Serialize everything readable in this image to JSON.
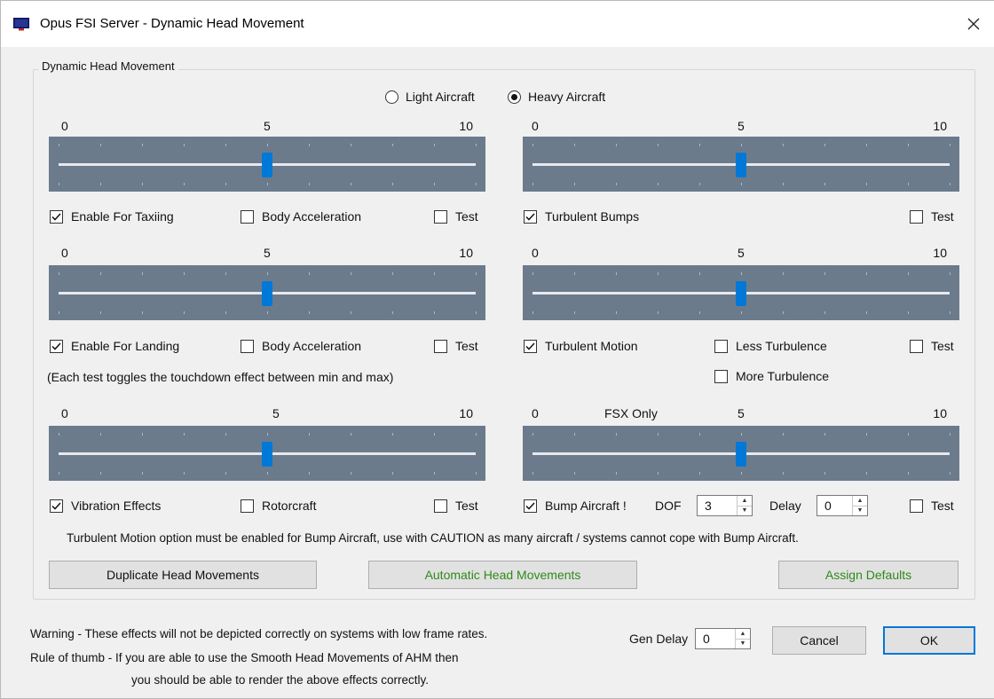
{
  "window": {
    "title": "Opus FSI Server - Dynamic Head Movement",
    "close_icon": "close-icon"
  },
  "group": {
    "legend": "Dynamic Head Movement"
  },
  "aircraft": {
    "light_label": "Light Aircraft",
    "heavy_label": "Heavy Aircraft",
    "selected": "heavy"
  },
  "scale": {
    "min": "0",
    "mid": "5",
    "max": "10"
  },
  "sliders": {
    "taxi": {
      "value": 5
    },
    "bumps": {
      "value": 5
    },
    "landing": {
      "value": 5
    },
    "motion": {
      "value": 5
    },
    "vibration": {
      "value": 5
    },
    "bump_aircraft": {
      "value": 5
    }
  },
  "row1": {
    "enable_taxiing": {
      "label": "Enable For Taxiing",
      "checked": true
    },
    "body_accel": {
      "label": "Body Acceleration",
      "checked": false
    },
    "test_left": {
      "label": "Test",
      "checked": false
    },
    "turbulent_bumps": {
      "label": "Turbulent Bumps",
      "checked": true
    },
    "test_right": {
      "label": "Test",
      "checked": false
    }
  },
  "row2": {
    "enable_landing": {
      "label": "Enable For Landing",
      "checked": true
    },
    "body_accel": {
      "label": "Body Acceleration",
      "checked": false
    },
    "test_left": {
      "label": "Test",
      "checked": false
    },
    "turbulent_motion": {
      "label": "Turbulent Motion",
      "checked": true
    },
    "less_turbulence": {
      "label": "Less Turbulence",
      "checked": false
    },
    "test_right": {
      "label": "Test",
      "checked": false
    },
    "more_turbulence": {
      "label": "More Turbulence",
      "checked": false
    },
    "note": "(Each test toggles the touchdown effect between min and max)"
  },
  "row3": {
    "fsx_only": "FSX Only",
    "vibration_effects": {
      "label": "Vibration Effects",
      "checked": true
    },
    "rotorcraft": {
      "label": "Rotorcraft",
      "checked": false
    },
    "test_left": {
      "label": "Test",
      "checked": false
    },
    "bump_aircraft": {
      "label": "Bump Aircraft !",
      "checked": true
    },
    "dof_label": "DOF",
    "dof_value": "3",
    "delay_label": "Delay",
    "delay_value": "0",
    "test_right": {
      "label": "Test",
      "checked": false
    }
  },
  "caution": "Turbulent Motion option must be enabled for Bump Aircraft, use with CAUTION as many aircraft / systems cannot cope with Bump Aircraft.",
  "buttons": {
    "duplicate": "Duplicate Head Movements",
    "automatic": "Automatic Head Movements",
    "assign_defaults": "Assign Defaults",
    "cancel": "Cancel",
    "ok": "OK"
  },
  "footer": {
    "warning": "Warning - These effects will not be depicted correctly on systems with low frame rates.",
    "rule1": "Rule of thumb - If you are able to use the Smooth Head Movements of AHM then",
    "rule2": "you should be able to render the above effects correctly.",
    "gen_delay_label": "Gen Delay",
    "gen_delay_value": "0"
  },
  "colors": {
    "slider_bg": "#6b7b8c",
    "thumb": "#0078d7",
    "green_text": "#2f8a1a"
  }
}
